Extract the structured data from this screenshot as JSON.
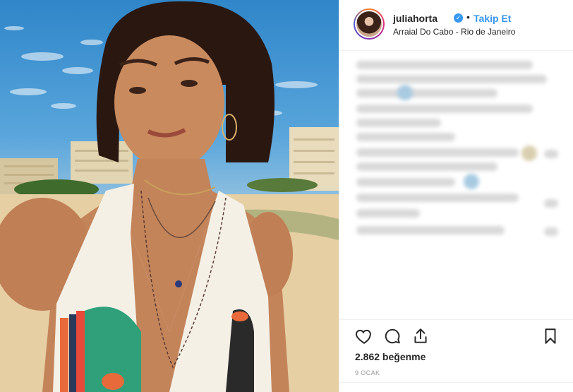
{
  "post": {
    "username": "juliahorta",
    "verified_glyph": "✓",
    "separator": "•",
    "follow_label": "Takip Et",
    "location": "Arraial Do Cabo - Rio de Janeiro",
    "likes": "2.862 beğenme",
    "date": "9 OCAK"
  },
  "icons": {
    "like": "heart-icon",
    "comment": "comment-icon",
    "share": "share-icon",
    "save": "bookmark-icon"
  },
  "colors": {
    "accent": "#3897f0",
    "text": "#262626",
    "muted": "#999999",
    "divider": "#efefef"
  }
}
